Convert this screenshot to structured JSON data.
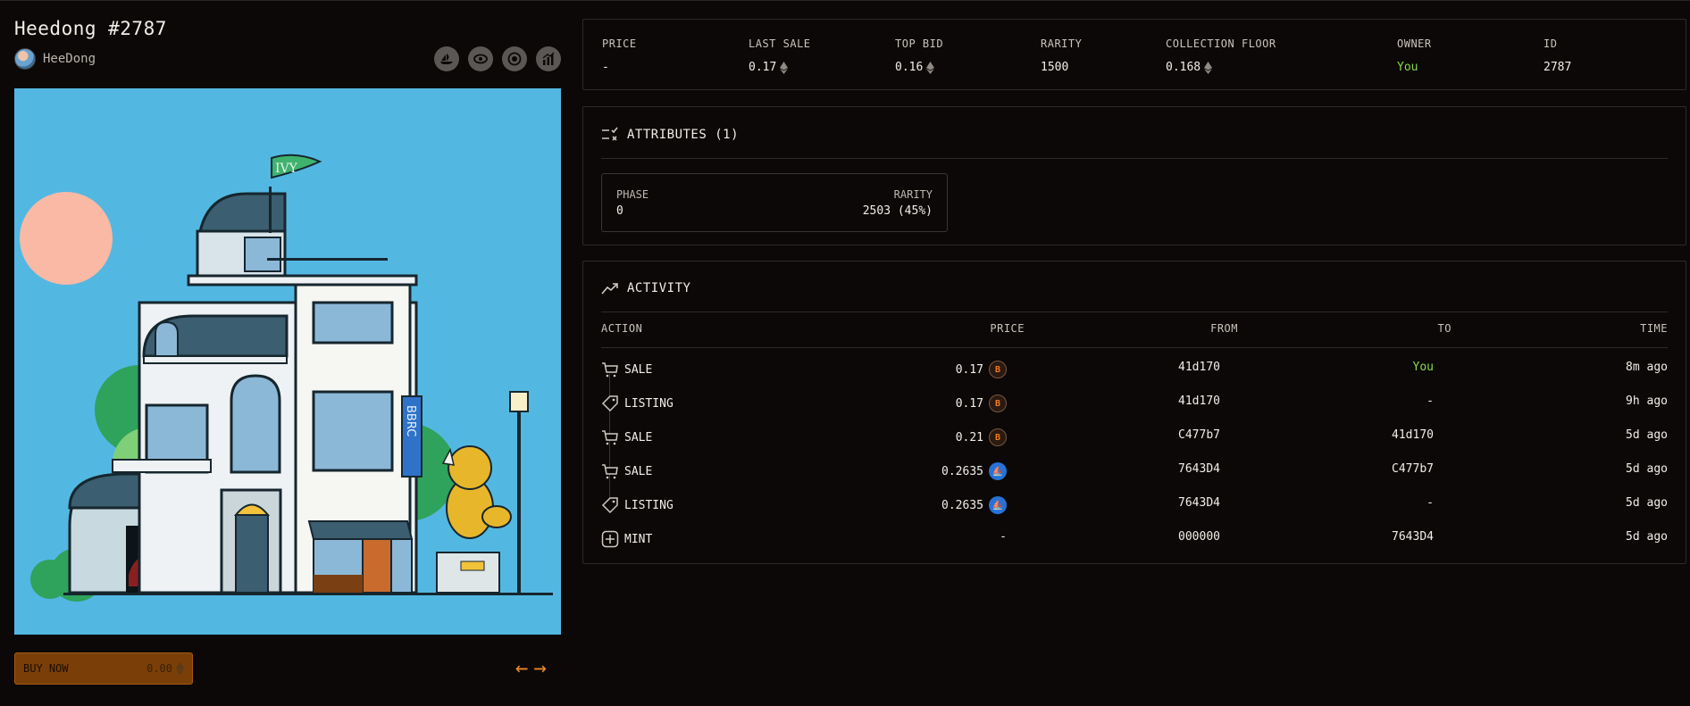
{
  "title": "Heedong #2787",
  "creator": "HeeDong",
  "icons": [
    "opensea-icon",
    "eye-icon",
    "target-icon",
    "chart-icon"
  ],
  "buy": {
    "label": "BUY NOW",
    "price": "0.00"
  },
  "stats": [
    {
      "label": "PRICE",
      "value": "-"
    },
    {
      "label": "LAST SALE",
      "value": "0.17",
      "eth": true
    },
    {
      "label": "TOP BID",
      "value": "0.16",
      "eth": true
    },
    {
      "label": "RARITY",
      "value": "1500"
    },
    {
      "label": "COLLECTION FLOOR",
      "value": "0.168",
      "eth": true
    },
    {
      "label": "OWNER",
      "value": "You"
    },
    {
      "label": "ID",
      "value": "2787"
    }
  ],
  "attributes": {
    "heading": "ATTRIBUTES (1)",
    "trait_label": "PHASE",
    "trait_value": "0",
    "rarity_label": "RARITY",
    "rarity_value": "2503 (45%)"
  },
  "activity": {
    "heading": "ACTIVITY",
    "columns": [
      "ACTION",
      "PRICE",
      "FROM",
      "TO",
      "TIME"
    ],
    "rows": [
      {
        "action": "SALE",
        "icon": "cart-icon",
        "price": "0.17",
        "coin": "orange",
        "from": "41d170",
        "to": "You",
        "time": "8m ago"
      },
      {
        "action": "LISTING",
        "icon": "tag-icon",
        "price": "0.17",
        "coin": "orange",
        "from": "41d170",
        "to": "-",
        "time": "9h ago"
      },
      {
        "action": "SALE",
        "icon": "cart-icon",
        "price": "0.21",
        "coin": "orange",
        "from": "C477b7",
        "to": "41d170",
        "time": "5d ago"
      },
      {
        "action": "SALE",
        "icon": "cart-icon",
        "price": "0.2635",
        "coin": "blue",
        "from": "7643D4",
        "to": "C477b7",
        "time": "5d ago"
      },
      {
        "action": "LISTING",
        "icon": "tag-icon",
        "price": "0.2635",
        "coin": "blue",
        "from": "7643D4",
        "to": "-",
        "time": "5d ago"
      },
      {
        "action": "MINT",
        "icon": "plus-icon",
        "price": "-",
        "coin": "",
        "from": "000000",
        "to": "7643D4",
        "time": "5d ago"
      }
    ]
  },
  "art": {
    "flag_text": "IVY",
    "banner_text": "BBRC"
  },
  "colors": {
    "accent": "#e8862a",
    "owner_green": "#86d94a",
    "art_bg": "#53b8e1"
  }
}
